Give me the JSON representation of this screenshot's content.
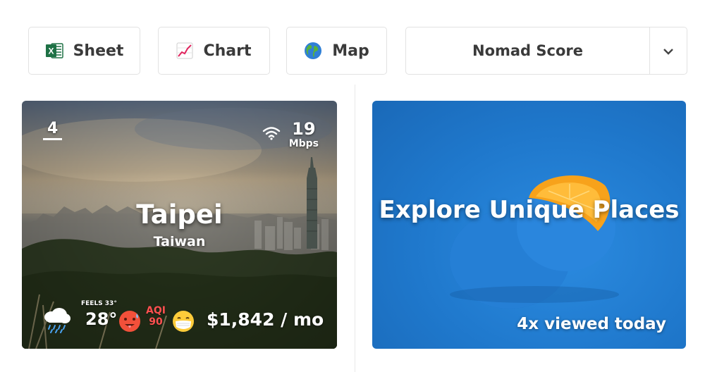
{
  "toolbar": {
    "sheet_label": "Sheet",
    "chart_label": "Chart",
    "map_label": "Map",
    "sort_selected": "Nomad Score"
  },
  "city_card": {
    "rank": "4",
    "internet_speed": "19",
    "internet_unit": "Mbps",
    "city": "Taipei",
    "country": "Taiwan",
    "feels_like": "FEELS 33°",
    "temperature": "28°",
    "aqi_label": "AQI",
    "aqi_value": "90",
    "cost": "$1,842 / mo",
    "icons": [
      "rain-cloud-icon",
      "hot-face-icon",
      "mask-face-icon",
      "wifi-icon"
    ]
  },
  "explore_card": {
    "title": "Explore Unique Places",
    "viewed": "4x viewed today"
  },
  "colors": {
    "border": "#e2e2e2",
    "aqi": "#ff5050",
    "explore_blue": "#1f78cc",
    "orange": "#f7a21b"
  }
}
